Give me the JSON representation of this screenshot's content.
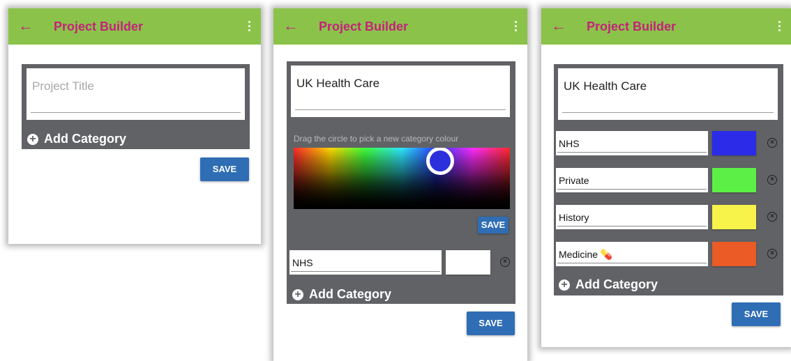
{
  "app": {
    "title": "Project Builder"
  },
  "screen1": {
    "project_title_placeholder": "Project Title",
    "add_category_label": "Add Category",
    "save_label": "SAVE"
  },
  "screen2": {
    "project_title_value": "UK Health Care",
    "picker_hint": "Drag the circle to pick a new category colour",
    "selected_color": "#2c2fdc",
    "picker_save_label": "SAVE",
    "category": {
      "name": "NHS",
      "color": "#ffffff"
    },
    "add_category_label": "Add Category",
    "save_label": "SAVE"
  },
  "screen3": {
    "project_title_value": "UK Health Care",
    "categories": [
      {
        "name": "NHS",
        "color": "#2b2be8"
      },
      {
        "name": "Private",
        "color": "#5cf046"
      },
      {
        "name": "History",
        "color": "#f7f34a"
      },
      {
        "name": "Medicine 💊",
        "color": "#ea5b26"
      }
    ],
    "add_category_label": "Add Category",
    "save_label": "SAVE"
  },
  "icons": {
    "back": "back-arrow-icon",
    "menu": "more-vert-icon",
    "add": "add-circle-icon",
    "remove": "remove-circle-icon"
  },
  "colors": {
    "appbar": "#8bc34a",
    "title": "#c5227a",
    "panel": "#616266",
    "button": "#2f6db5"
  }
}
